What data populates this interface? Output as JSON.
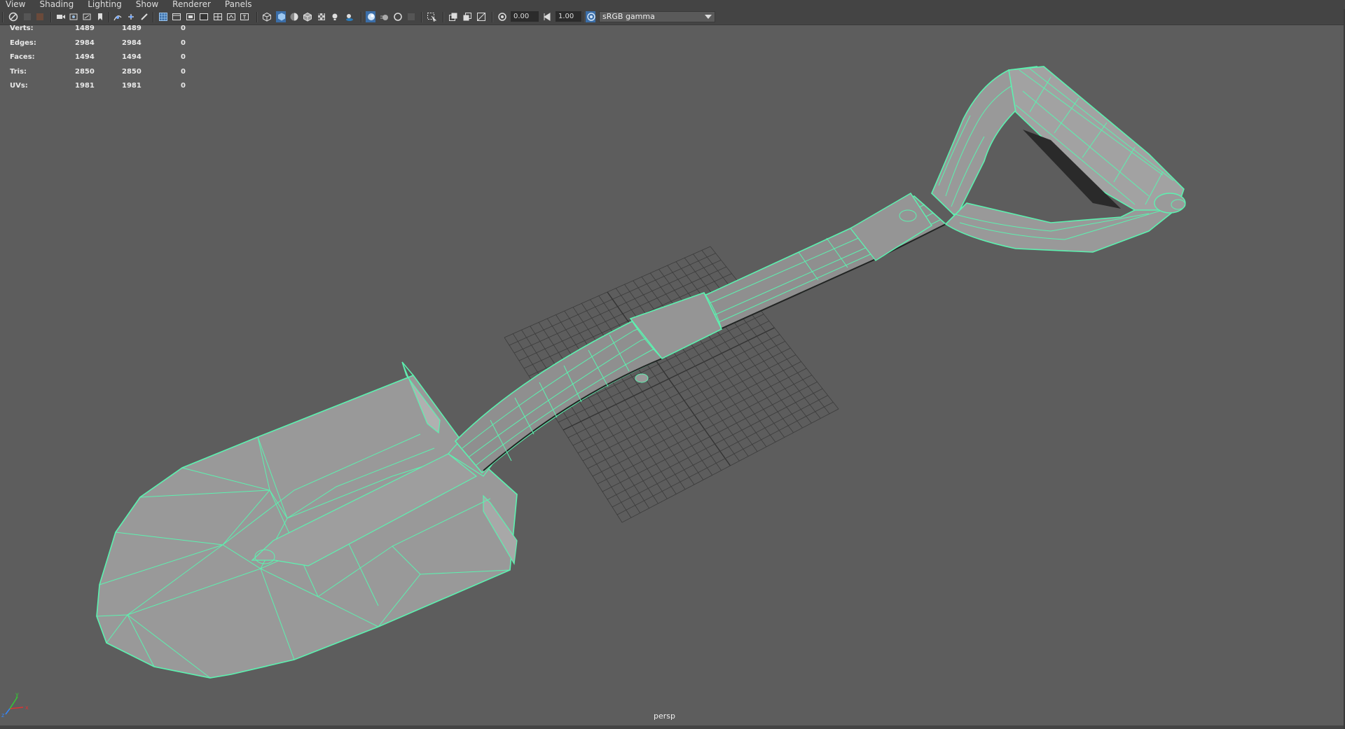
{
  "menu": [
    "View",
    "Shading",
    "Lighting",
    "Show",
    "Renderer",
    "Panels"
  ],
  "toolbar": {
    "exposure": "0.00",
    "gamma": "1.00",
    "color_space": "sRGB gamma"
  },
  "hud": {
    "rows": [
      {
        "label": "Verts:",
        "v1": "1489",
        "v2": "1489",
        "v3": "0"
      },
      {
        "label": "Edges:",
        "v1": "2984",
        "v2": "2984",
        "v3": "0"
      },
      {
        "label": "Faces:",
        "v1": "1494",
        "v2": "1494",
        "v3": "0"
      },
      {
        "label": "Tris:",
        "v1": "2850",
        "v2": "2850",
        "v3": "0"
      },
      {
        "label": "UVs:",
        "v1": "1981",
        "v2": "1981",
        "v3": "0"
      }
    ]
  },
  "camera_name": "persp",
  "colors": {
    "wire": "#5cf2b0",
    "mesh": "#999999",
    "background": "#5d5d5d",
    "grid": "#3c3c3c"
  }
}
